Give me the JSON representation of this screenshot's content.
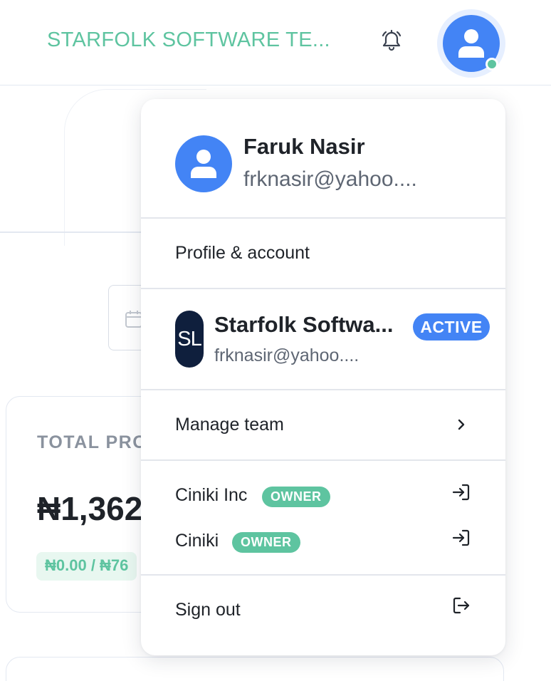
{
  "header": {
    "org_title": "STARFOLK SOFTWARE TE...",
    "notification_icon": "bell-icon",
    "avatar_icon": "user-icon",
    "online_status_color": "#5ec4a0"
  },
  "background": {
    "card_label": "TOTAL PRO",
    "card_amount": "₦1,362",
    "card_pill": "₦0.00 / ₦76"
  },
  "dropdown": {
    "user": {
      "name": "Faruk Nasir",
      "email": "frknasir@yahoo...."
    },
    "profile_link": "Profile & account",
    "current_team": {
      "logo_initials": "SL",
      "name": "Starfolk Softwa...",
      "email": "frknasir@yahoo....",
      "badge": "ACTIVE"
    },
    "manage_team": "Manage team",
    "other_teams": [
      {
        "name": "Ciniki Inc",
        "badge": "OWNER"
      },
      {
        "name": "Ciniki",
        "badge": "OWNER"
      }
    ],
    "sign_out": "Sign out"
  },
  "colors": {
    "accent_blue": "#4384f5",
    "accent_green": "#5ec4a0",
    "navy_logo": "#0f1f3d"
  }
}
